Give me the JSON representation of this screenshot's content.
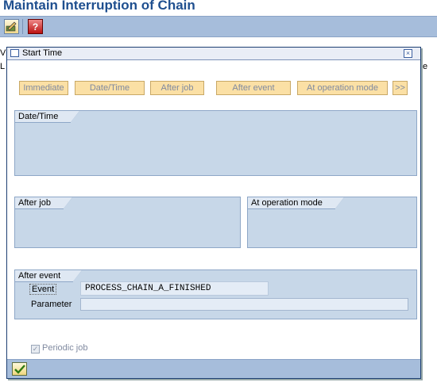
{
  "app": {
    "title": "Maintain Interruption of Chain",
    "bg_text_1": "V",
    "bg_text_2": "L",
    "bg_text_3": "e"
  },
  "icons": {
    "toolbar_1": "edit-pencil-icon",
    "toolbar_2": "help-icon",
    "dialog": "window-icon",
    "close": "close-icon",
    "ok": "checkmark-icon"
  },
  "dialog": {
    "title": "Start Time",
    "close_glyph": "×",
    "buttons": {
      "immediate": "Immediate",
      "datetime": "Date/Time",
      "after_job": "After job",
      "after_event": "After event",
      "at_operation_mode": "At operation mode",
      "more": ">>"
    },
    "groups": {
      "datetime": "Date/Time",
      "after_job": "After job",
      "at_operation_mode": "At operation mode",
      "after_event": "After event"
    },
    "fields": {
      "event_label": "Event",
      "event_value": "PROCESS_CHAIN_A_FINISHED",
      "parameter_label": "Parameter",
      "parameter_value": ""
    },
    "periodic": {
      "label": "Periodic job",
      "checked": true
    }
  },
  "colors": {
    "title": "#1f4f8f",
    "toolbar": "#a6bddb",
    "group_bg": "#c7d7e8",
    "button_bg": "#fbe0a5"
  }
}
